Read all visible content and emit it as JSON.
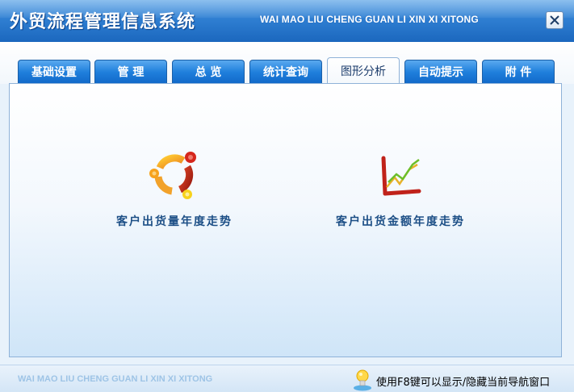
{
  "window": {
    "title": "外贸流程管理信息系统",
    "subtitle": "WAI MAO LIU CHENG GUAN LI XIN XI XITONG"
  },
  "tabs": [
    {
      "label": "基础设置",
      "active": false
    },
    {
      "label": "管  理",
      "active": false
    },
    {
      "label": "总  览",
      "active": false
    },
    {
      "label": "统计查询",
      "active": false
    },
    {
      "label": "图形分析",
      "active": true
    },
    {
      "label": "自动提示",
      "active": false
    },
    {
      "label": "附  件",
      "active": false
    }
  ],
  "features": [
    {
      "label": "客户出货量年度走势",
      "icon": "ubuntu-circle-icon"
    },
    {
      "label": "客户出货金额年度走势",
      "icon": "line-chart-icon"
    }
  ],
  "statusbar": {
    "brand": "WAI MAO LIU CHENG GUAN LI XIN XI XITONG",
    "hint": "使用F8键可以显示/隐藏当前导航窗口",
    "hint_icon": "lightbulb-icon"
  },
  "colors": {
    "title_bar": "#2f7fd2",
    "tab": "#1f7fdc",
    "label": "#1d4f86"
  }
}
